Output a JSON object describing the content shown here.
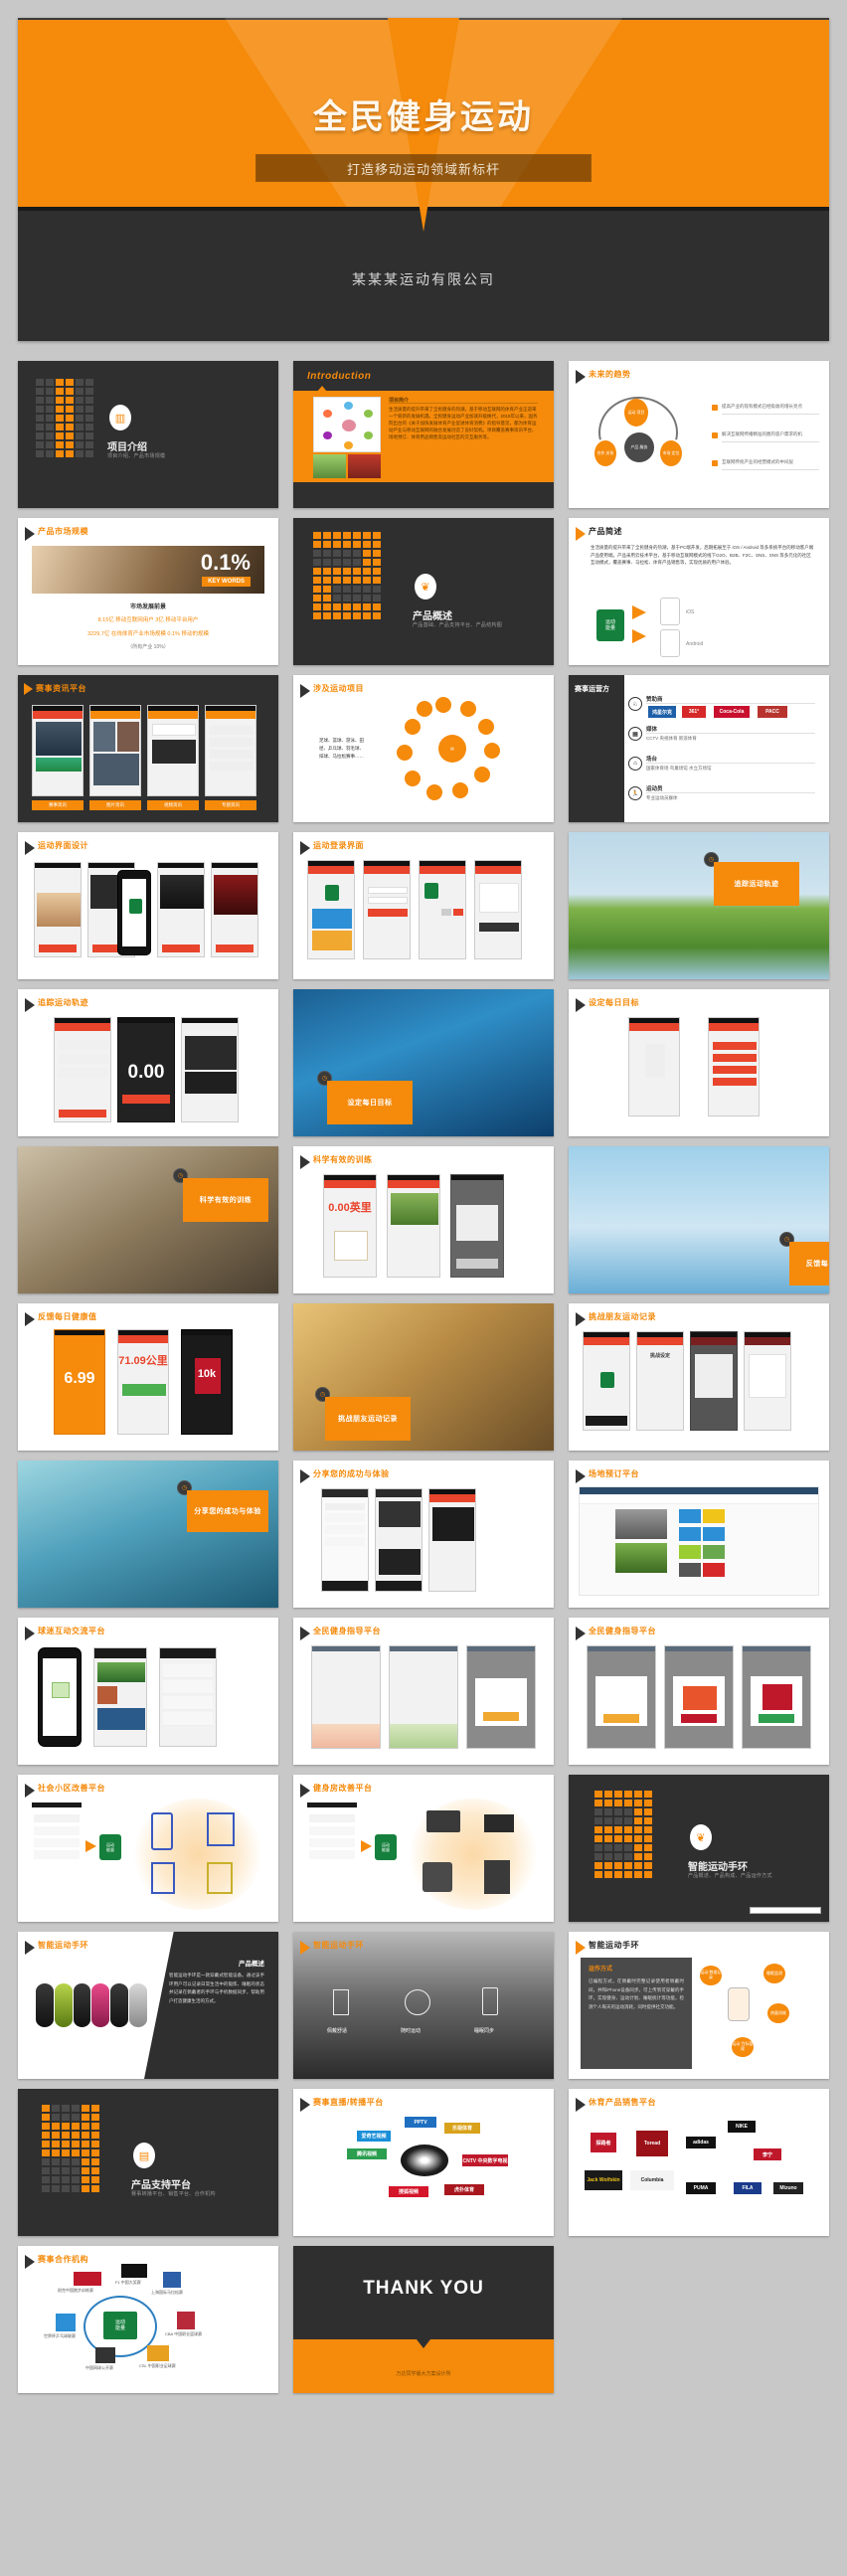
{
  "hero": {
    "title": "全民健身运动",
    "subtitle": "打造移动运动领域新标杆",
    "company": "某某某运动有限公司",
    "accent": "#f58a0b",
    "dark": "#2f2f2f"
  },
  "slides": [
    {
      "title": "项目介绍",
      "subtitle": "项目介绍、产品市场规模",
      "kind": "cover-dark"
    },
    {
      "title": "Introduction",
      "subtitle": "项目简介",
      "kind": "intro-orange"
    },
    {
      "title": "未来的趋势",
      "subtitle": "",
      "kind": "trend-circle",
      "bullets": [
        "提高产业的现有模式已经吸收的增长亮点",
        "解决互联网传播精准的圈内容户需求的机",
        "互联网传统产业的经营模式的中间层"
      ],
      "nodes": [
        "运动\n项目",
        "产品\n服务",
        "合作\n关系",
        "市场\n定位"
      ]
    },
    {
      "title": "产品市场规模",
      "subtitle": "市场发展前景",
      "kind": "market",
      "keyword_value": "0.1%",
      "keyword_label": "KEY WORDS",
      "stats": [
        "8.15亿 移动互联网用户 3亿 移动平台用户",
        "3229.7亿 在线体育产业市场规模 0.1% 移动的规模",
        "（所有产业 10%）"
      ]
    },
    {
      "title": "产品概述",
      "subtitle": "产品基础、产品支持平台、产品结构图",
      "kind": "cover-dark2"
    },
    {
      "title": "产品简述",
      "subtitle": "",
      "kind": "product-brief",
      "body": "生活质量的提升带来了全民健身的热潮，基于PC端开发，后期拓展至于 iOS / Android 等多系统平台的移动客户端产品使用端。产品采用云技术平台，基于移动互联网模式的线下O2O、B2B、F2C、SNS、SNS 等多元化的社区互动模式，覆盖赛事、马拉松、体育产品销售等，实现优质的用户体验。",
      "badge": "运动\n能量",
      "phones": [
        "iOS",
        "Android"
      ]
    },
    {
      "title": "赛事资讯平台",
      "subtitle": "",
      "kind": "phones-dark",
      "buttons": [
        "赛事资讯",
        "图片资讯",
        "视频资讯",
        "专题资讯"
      ]
    },
    {
      "title": "涉及运动项目",
      "subtitle": "",
      "kind": "sports-wheel",
      "note": "足球、篮球、游泳、田径、乒乓球、羽毛球、排球、马拉松赛事……"
    },
    {
      "title": "赛事运营方",
      "subtitle": "",
      "kind": "operators",
      "rows": [
        {
          "label": "赞助商",
          "sub": "",
          "logos": [
            "鸿星尔克",
            "361°",
            "Coca-Cola",
            "PACC"
          ]
        },
        {
          "label": "媒体",
          "sub": "CCTV 央视体育 新浪体育",
          "logos": []
        },
        {
          "label": "场台",
          "sub": "国家体育场 鸟巢场馆 水立方场馆",
          "logos": []
        },
        {
          "label": "运动员",
          "sub": "专业运动员群体",
          "logos": []
        }
      ]
    },
    {
      "title": "运动界面设计",
      "subtitle": "",
      "kind": "phones-light"
    },
    {
      "title": "运动登录界面",
      "subtitle": "",
      "kind": "phones-login"
    },
    {
      "title": "追踪运动轨迹",
      "subtitle": "",
      "kind": "photo-caption",
      "photo": "runner-grass"
    },
    {
      "title": "追踪运动轨迹",
      "subtitle": "",
      "kind": "track-phones",
      "metric": "0.00"
    },
    {
      "title": "设定每日目标",
      "subtitle": "",
      "kind": "photo-caption",
      "photo": "swimmer"
    },
    {
      "title": "设定每日目标",
      "subtitle": "",
      "kind": "goal-phones"
    },
    {
      "title": "科学有效的训练",
      "subtitle": "",
      "kind": "photo-caption",
      "photo": "cyclist"
    },
    {
      "title": "科学有效的训练",
      "subtitle": "",
      "kind": "train-phones",
      "metric": "0.00英里"
    },
    {
      "title": "反馈每日健康值",
      "subtitle": "",
      "kind": "photo-caption",
      "photo": "yoga"
    },
    {
      "title": "反馈每日健康值",
      "subtitle": "",
      "kind": "health-phones",
      "metrics": [
        "6.99",
        "71.09公里",
        "10k"
      ]
    },
    {
      "title": "挑战朋友运动记录",
      "subtitle": "",
      "kind": "photo-caption",
      "photo": "climber"
    },
    {
      "title": "挑战朋友运动记录",
      "subtitle": "",
      "kind": "challenge-phones",
      "metric": "挑战设定"
    },
    {
      "title": "分享您的成功与体验",
      "subtitle": "",
      "kind": "photo-caption",
      "photo": "champion"
    },
    {
      "title": "分享您的成功与体验",
      "subtitle": "",
      "kind": "share-phones"
    },
    {
      "title": "场地预订平台",
      "subtitle": "",
      "kind": "booking"
    },
    {
      "title": "球迷互动交流平台",
      "subtitle": "",
      "kind": "fan-phones"
    },
    {
      "title": "全民健身指导平台",
      "subtitle": "",
      "kind": "guide-phones-a"
    },
    {
      "title": "全民健身指导平台",
      "subtitle": "",
      "kind": "guide-phones-b"
    },
    {
      "title": "社会小区改善平台",
      "subtitle": "",
      "kind": "community",
      "badge": "运动\n能量"
    },
    {
      "title": "健身房改善平台",
      "subtitle": "",
      "kind": "gym",
      "badge": "运动\n能量"
    },
    {
      "title": "智能运动手环",
      "subtitle": "产品概述、产品构成、产品运作方式",
      "kind": "cover-dark3"
    },
    {
      "title": "智能运动手环",
      "subtitle": "产品概述",
      "kind": "band-product",
      "body": "智能运动手环是一款穿戴式智能设备。通过该手环用户可以记录日常生活中的锻炼、睡眠的状态并记录在佩戴者的手环与手机数据同步，帮助用户打造健康生活的方式。"
    },
    {
      "title": "智能运动手环",
      "subtitle": "",
      "kind": "band-photo",
      "features": [
        "佩戴舒适",
        "随时运动",
        "睡眠同步"
      ]
    },
    {
      "title": "智能运动手环",
      "subtitle": "运作方式",
      "kind": "band-flow",
      "body": "已编程方式，在佩戴时完整记录使用者佩戴时间，并和iPhone设备同步。可上传到可穿戴的手环，实现健身、运动计划、睡眠统计等功能，检测个人每天的运动消耗，同时提供社交功能。",
      "nodes": [
        "运动\n数据记录",
        "睡眠监测",
        "热量消耗",
        "运动\n目标管理"
      ]
    },
    {
      "title": "产品支持平台",
      "subtitle": "赛事转播平台、销售平台、合作机构",
      "kind": "cover-dark4"
    },
    {
      "title": "赛事直播/转播平台",
      "subtitle": "",
      "kind": "media-logos",
      "logos": [
        "爱奇艺视频",
        "PPTV",
        "乐视体育",
        "腾讯视频",
        "CNTV 中央数字电视",
        "搜狐视频",
        "虎扑体育"
      ]
    },
    {
      "title": "休育产品销售平台",
      "subtitle": "",
      "kind": "brand-logos",
      "logos": [
        "探路者",
        "Toread",
        "Jack Wolfskin",
        "Columbia",
        "NIKE",
        "adidas",
        "李宁",
        "FILA",
        "PUMA",
        "Mizuno"
      ]
    },
    {
      "title": "赛事合作机构",
      "subtitle": "",
      "kind": "partners",
      "center": "运动\n能量",
      "logos": [
        "耐克中国跑步训练赛",
        "F1 中国大奖赛",
        "上海国际马拉松赛",
        "CBA 中国职业篮球赛",
        "CSL 中国职业足球赛",
        "中国网球公开赛",
        "世界杯乒乓球联赛"
      ]
    },
    {
      "title": "THANK YOU",
      "subtitle": "万达同学版大方案设计所",
      "kind": "thankyou"
    }
  ]
}
